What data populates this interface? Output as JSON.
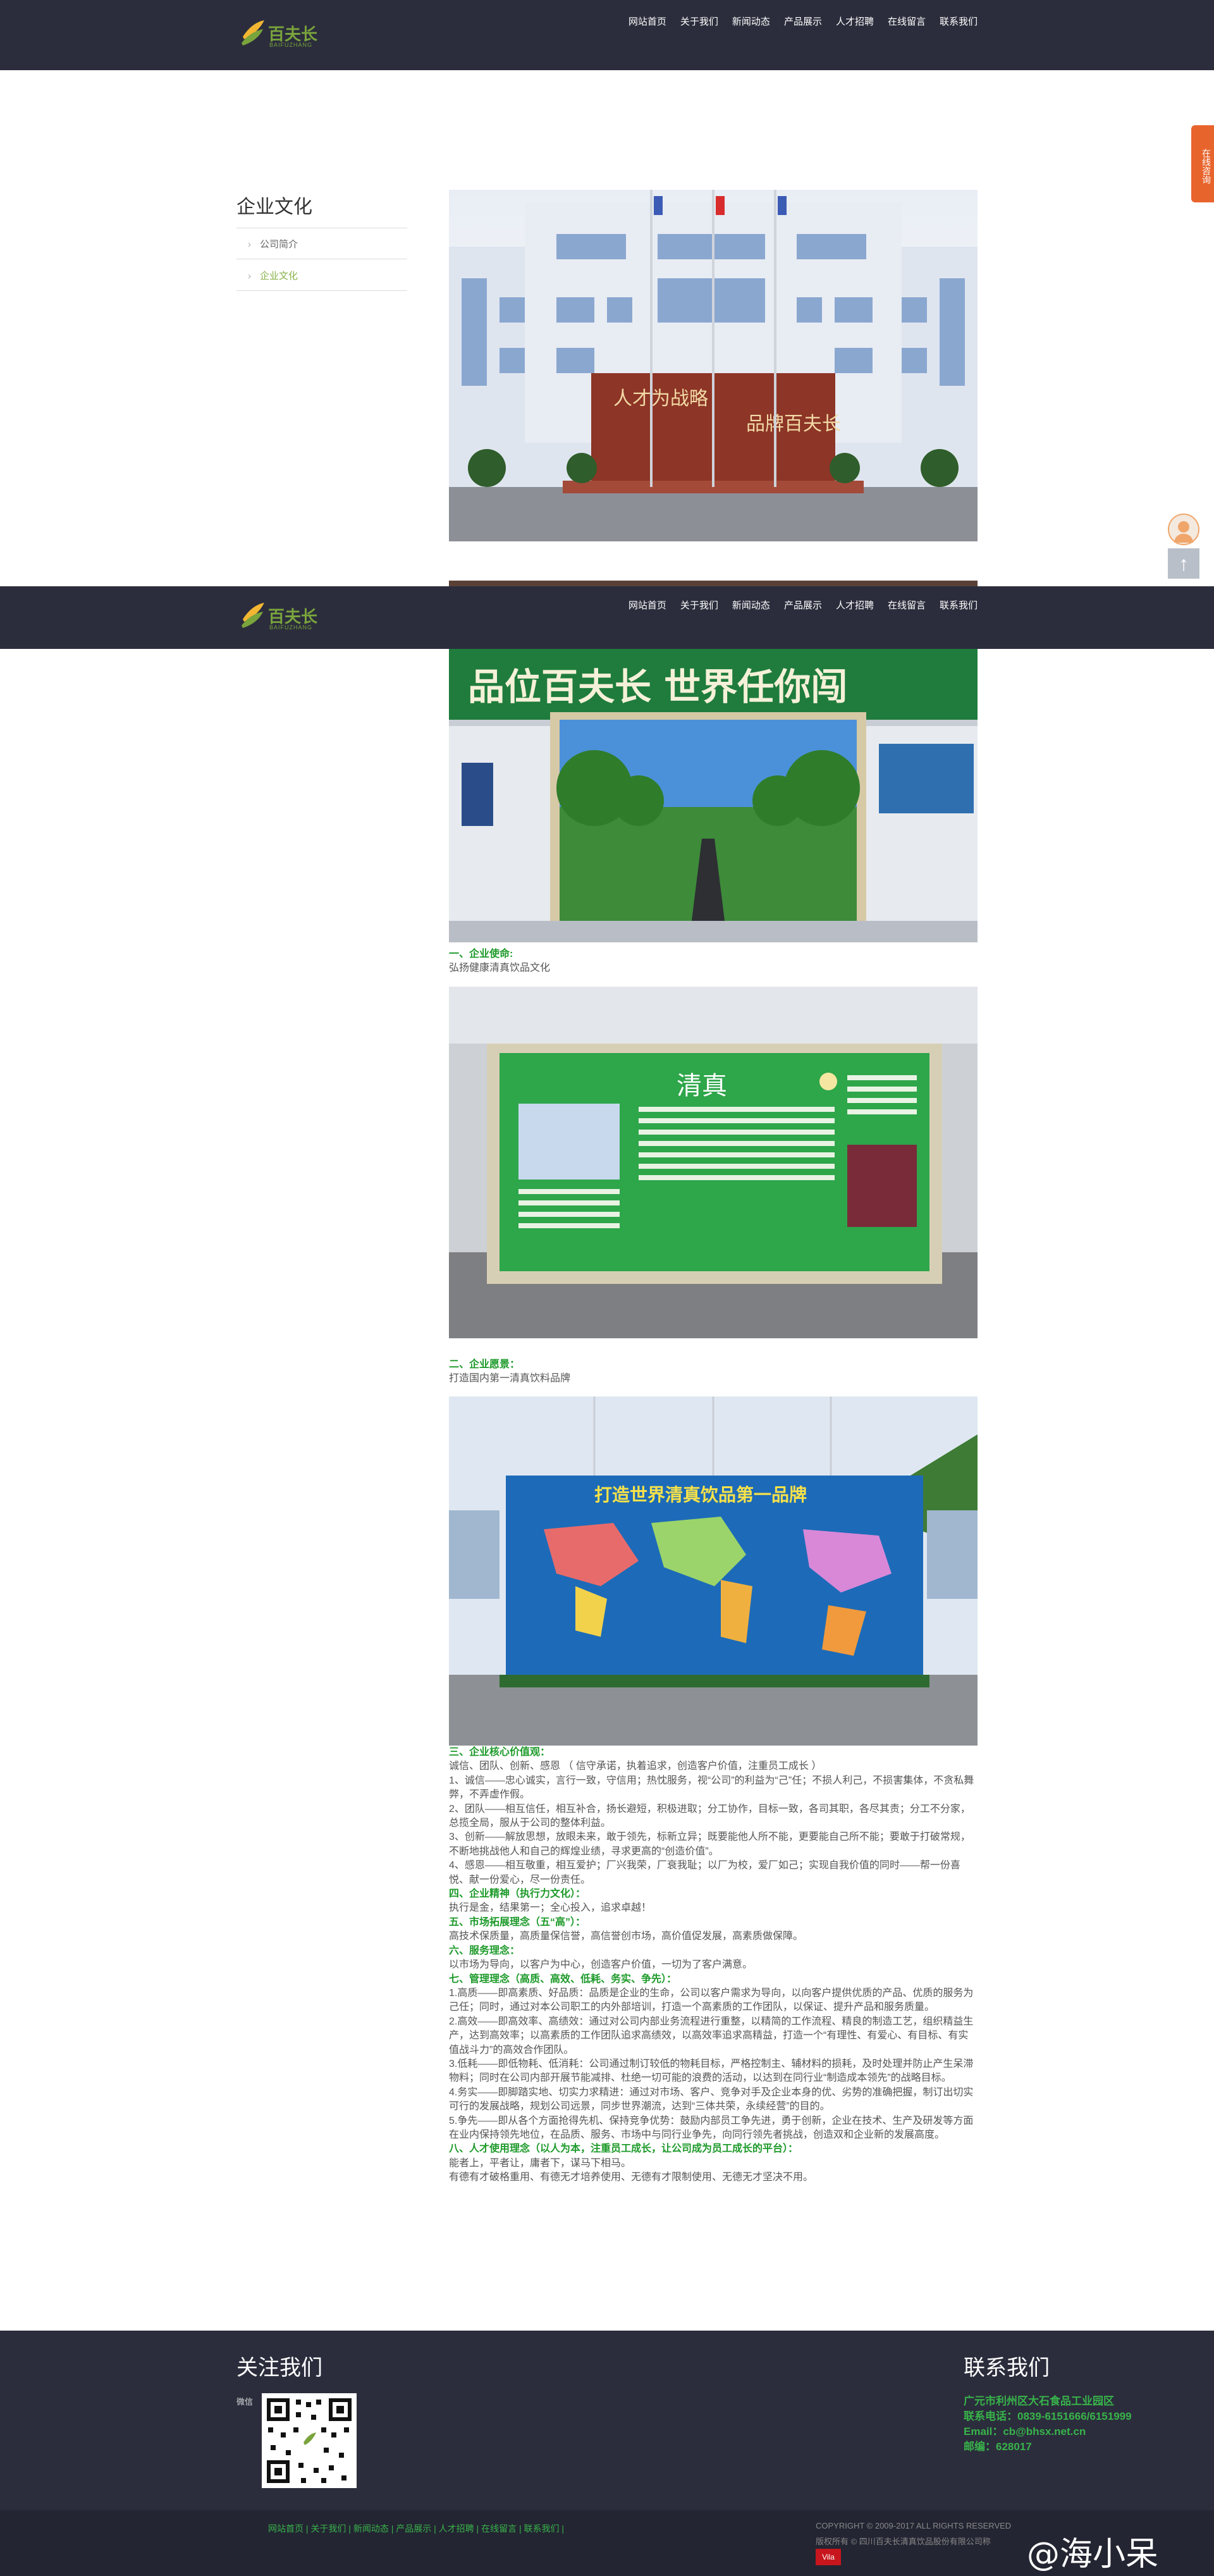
{
  "brand": {
    "logo_text": "百夫长",
    "logo_sub": "BAIFUZHANG"
  },
  "nav": [
    "网站首页",
    "关于我们",
    "新闻动态",
    "产品展示",
    "人才招聘",
    "在线留言",
    "联系我们"
  ],
  "floating": {
    "tab_label": "在线咨询",
    "back_to_top": "↑"
  },
  "sidebar": {
    "title": "企业文化",
    "items": [
      {
        "label": "公司简介",
        "active": false
      },
      {
        "label": "企业文化",
        "active": true
      }
    ]
  },
  "photos": {
    "building_slogan_left": "人才为战略",
    "building_slogan_right": "品牌百夫长",
    "hall_banner": "品位百夫长   世界任你闯",
    "board_title": "清真",
    "map_title": "打造世界清真饮品第一品牌"
  },
  "captions": {
    "mission_title": "一、企业使命:",
    "mission_text": "弘扬健康清真饮品文化",
    "vision_title": "二、企业愿景：",
    "vision_text": "打造国内第一清真饮料品牌"
  },
  "body_lines": [
    {
      "text": "三、企业核心价值观：",
      "heading": true
    },
    {
      "text": "诚信、团队、创新、感恩 （ 信守承诺，执着追求，创造客户价值，注重员工成长 ）",
      "heading": false
    },
    {
      "text": "1、诚信——忠心诚实，言行一致，守信用；热忱服务，视“公司”的利益为“己”任；不损人利己，不损害集体，不贪私舞弊，不弄虚作假。",
      "heading": false
    },
    {
      "text": "2、团队——相互信任，相互补合，扬长避短，积极进取；分工协作，目标一致，各司其职，各尽其责；分工不分家，总揽全局，服从于公司的整体利益。",
      "heading": false
    },
    {
      "text": "3、创新——解放思想，放眼未来，敢于领先，标新立异；既要能他人所不能，更要能自己所不能；要敢于打破常规，不断地挑战他人和自己的辉煌业绩，寻求更高的“创造价值”。",
      "heading": false
    },
    {
      "text": "4、感恩——相互敬重，相互爱护；厂兴我荣，厂衰我耻；以厂为校，爱厂如己；实现自我价值的同时——帮一份喜悦、献一份爱心，尽一份责任。",
      "heading": false
    },
    {
      "text": "四、企业精神（执行力文化）：",
      "heading": true
    },
    {
      "text": "执行是金，结果第一；全心投入，追求卓越！",
      "heading": false
    },
    {
      "text": "五、市场拓展理念（五“高”）：",
      "heading": true
    },
    {
      "text": "高技术保质量，高质量保信誉，高信誉创市场，高价值促发展，高素质做保障。",
      "heading": false
    },
    {
      "text": "六、服务理念：",
      "heading": true
    },
    {
      "text": "以市场为导向，以客户为中心，创造客户价值，一切为了客户满意。",
      "heading": false
    },
    {
      "text": "七、管理理念（高质、高效、低耗、务实、争先）：",
      "heading": true
    },
    {
      "text": "1.高质——即高素质、好品质：品质是企业的生命，公司以客户需求为导向，以向客户提供优质的产品、优质的服务为己任；同时，通过对本公司职工的内外部培训，打造一个高素质的工作团队，以保证、提升产品和服务质量。",
      "heading": false
    },
    {
      "text": "2.高效——即高效率、高绩效：通过对公司内部业务流程进行重整，以精简的工作流程、精良的制造工艺，组织精益生产，达到高效率；以高素质的工作团队追求高绩效，以高效率追求高精益，打造一个“有理性、有爱心、有目标、有实值战斗力”的高效合作团队。",
      "heading": false
    },
    {
      "text": "3.低耗——即低物耗、低消耗：公司通过制订较低的物耗目标，严格控制主、辅材料的损耗，及时处理并防止产生呆滞物料；同时在公司内部开展节能减排、杜绝一切可能的浪费的活动，以达到在同行业“制造成本领先”的战略目标。",
      "heading": false
    },
    {
      "text": "4.务实——即脚踏实地、切实力求精进：通过对市场、客户、竞争对手及企业本身的优、劣势的准确把握，制订出切实可行的发展战略，规划公司远景，同步世界潮流，达到“三体共荣，永续经营”的目的。",
      "heading": false
    },
    {
      "text": "5.争先——即从各个方面抢得先机、保持竞争优势：鼓励内部员工争先进，勇于创新，企业在技术、生产及研发等方面在业内保持领先地位，在品质、服务、市场中与同行业争先，向同行领先者挑战，创造双和企业新的发展高度。",
      "heading": false
    },
    {
      "text": "八、人才使用理念（以人为本，注重员工成长，让公司成为员工成长的平台）：",
      "heading": true
    },
    {
      "text": "能者上，平者让，庸者下，谋马下相马。",
      "heading": false
    },
    {
      "text": "有德有才破格重用、有德无才培养使用、无德有才限制使用、无德无才坚决不用。",
      "heading": false
    }
  ],
  "footer": {
    "follow_title": "关注我们",
    "wechat_label": "微信",
    "contact_title": "联系我们",
    "address": "广元市利州区大石食品工业园区",
    "phone": "联系电话：0839-6151666/6151999",
    "email": "Email：cb@bhsx.net.cn",
    "postcode": "邮编：628017",
    "links": "网站首页 | 关于我们 | 新闻动态 | 产品展示 | 人才招聘 | 在线留言 | 联系我们 |",
    "copyright": "COPYRIGHT © 2009-2017 ALL RIGHTS RESERVED",
    "owner": "版权所有 © 四川百夫长清真饮品股份有限公司称",
    "badge": "Vila",
    "watermark": "@海小呆"
  },
  "colors": {
    "header": "#2b2d3c",
    "accent_green": "#1d9a2a",
    "footer_green": "#38b34a",
    "float_orange": "#e8642d"
  }
}
